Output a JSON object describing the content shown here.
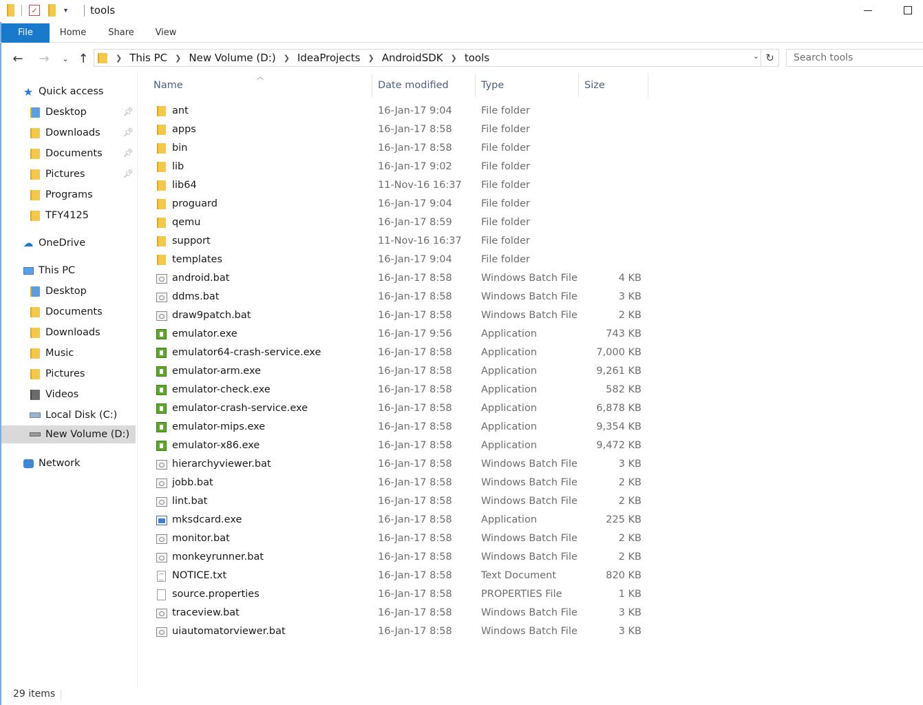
{
  "window": {
    "title": "tools"
  },
  "ribbon": {
    "tabs": [
      {
        "label": "File"
      },
      {
        "label": "Home"
      },
      {
        "label": "Share"
      },
      {
        "label": "View"
      }
    ]
  },
  "address": {
    "crumbs": [
      "This PC",
      "New Volume (D:)",
      "IdeaProjects",
      "AndroidSDK",
      "tools"
    ]
  },
  "search": {
    "placeholder": "Search tools"
  },
  "nav": {
    "items": [
      {
        "label": "Quick access",
        "icon": "star-icon",
        "level": 0
      },
      {
        "label": "Desktop",
        "icon": "desktop-folder-icon",
        "level": 1,
        "pinned": true
      },
      {
        "label": "Downloads",
        "icon": "downloads-folder-icon",
        "level": 1,
        "pinned": true
      },
      {
        "label": "Documents",
        "icon": "documents-folder-icon",
        "level": 1,
        "pinned": true
      },
      {
        "label": "Pictures",
        "icon": "pictures-folder-icon",
        "level": 1,
        "pinned": true
      },
      {
        "label": "Programs",
        "icon": "folder-icon",
        "level": 1
      },
      {
        "label": "TFY4125",
        "icon": "folder-icon",
        "level": 1
      },
      {
        "label": "OneDrive",
        "icon": "cloud-icon",
        "level": 0
      },
      {
        "label": "This PC",
        "icon": "computer-icon",
        "level": 0
      },
      {
        "label": "Desktop",
        "icon": "desktop-folder-icon",
        "level": 1
      },
      {
        "label": "Documents",
        "icon": "documents-folder-icon",
        "level": 1
      },
      {
        "label": "Downloads",
        "icon": "downloads-folder-icon",
        "level": 1
      },
      {
        "label": "Music",
        "icon": "music-folder-icon",
        "level": 1
      },
      {
        "label": "Pictures",
        "icon": "pictures-folder-icon",
        "level": 1
      },
      {
        "label": "Videos",
        "icon": "videos-folder-icon",
        "level": 1
      },
      {
        "label": "Local Disk (C:)",
        "icon": "drive-icon",
        "level": 1
      },
      {
        "label": "New Volume (D:)",
        "icon": "drive-icon",
        "level": 1,
        "selected": true
      },
      {
        "label": "Network",
        "icon": "network-icon",
        "level": 0
      }
    ]
  },
  "columns": {
    "name": "Name",
    "date": "Date modified",
    "type": "Type",
    "size": "Size"
  },
  "files": [
    {
      "name": "ant",
      "date": "16-Jan-17 9:04",
      "type": "File folder",
      "size": "",
      "icon": "folder"
    },
    {
      "name": "apps",
      "date": "16-Jan-17 8:58",
      "type": "File folder",
      "size": "",
      "icon": "folder"
    },
    {
      "name": "bin",
      "date": "16-Jan-17 8:58",
      "type": "File folder",
      "size": "",
      "icon": "folder"
    },
    {
      "name": "lib",
      "date": "16-Jan-17 9:02",
      "type": "File folder",
      "size": "",
      "icon": "folder"
    },
    {
      "name": "lib64",
      "date": "11-Nov-16 16:37",
      "type": "File folder",
      "size": "",
      "icon": "folder"
    },
    {
      "name": "proguard",
      "date": "16-Jan-17 9:04",
      "type": "File folder",
      "size": "",
      "icon": "folder"
    },
    {
      "name": "qemu",
      "date": "16-Jan-17 8:59",
      "type": "File folder",
      "size": "",
      "icon": "folder"
    },
    {
      "name": "support",
      "date": "11-Nov-16 16:37",
      "type": "File folder",
      "size": "",
      "icon": "folder"
    },
    {
      "name": "templates",
      "date": "16-Jan-17 9:04",
      "type": "File folder",
      "size": "",
      "icon": "folder"
    },
    {
      "name": "android.bat",
      "date": "16-Jan-17 8:58",
      "type": "Windows Batch File",
      "size": "4 KB",
      "icon": "bat"
    },
    {
      "name": "ddms.bat",
      "date": "16-Jan-17 8:58",
      "type": "Windows Batch File",
      "size": "3 KB",
      "icon": "bat"
    },
    {
      "name": "draw9patch.bat",
      "date": "16-Jan-17 8:58",
      "type": "Windows Batch File",
      "size": "2 KB",
      "icon": "bat"
    },
    {
      "name": "emulator.exe",
      "date": "16-Jan-17 9:56",
      "type": "Application",
      "size": "743 KB",
      "icon": "exe"
    },
    {
      "name": "emulator64-crash-service.exe",
      "date": "16-Jan-17 8:58",
      "type": "Application",
      "size": "7,000 KB",
      "icon": "exe"
    },
    {
      "name": "emulator-arm.exe",
      "date": "16-Jan-17 8:58",
      "type": "Application",
      "size": "9,261 KB",
      "icon": "exe"
    },
    {
      "name": "emulator-check.exe",
      "date": "16-Jan-17 8:58",
      "type": "Application",
      "size": "582 KB",
      "icon": "exe"
    },
    {
      "name": "emulator-crash-service.exe",
      "date": "16-Jan-17 8:58",
      "type": "Application",
      "size": "6,878 KB",
      "icon": "exe"
    },
    {
      "name": "emulator-mips.exe",
      "date": "16-Jan-17 8:58",
      "type": "Application",
      "size": "9,354 KB",
      "icon": "exe"
    },
    {
      "name": "emulator-x86.exe",
      "date": "16-Jan-17 8:58",
      "type": "Application",
      "size": "9,472 KB",
      "icon": "exe"
    },
    {
      "name": "hierarchyviewer.bat",
      "date": "16-Jan-17 8:58",
      "type": "Windows Batch File",
      "size": "3 KB",
      "icon": "bat"
    },
    {
      "name": "jobb.bat",
      "date": "16-Jan-17 8:58",
      "type": "Windows Batch File",
      "size": "2 KB",
      "icon": "bat"
    },
    {
      "name": "lint.bat",
      "date": "16-Jan-17 8:58",
      "type": "Windows Batch File",
      "size": "2 KB",
      "icon": "bat"
    },
    {
      "name": "mksdcard.exe",
      "date": "16-Jan-17 8:58",
      "type": "Application",
      "size": "225 KB",
      "icon": "exe-blue"
    },
    {
      "name": "monitor.bat",
      "date": "16-Jan-17 8:58",
      "type": "Windows Batch File",
      "size": "2 KB",
      "icon": "bat"
    },
    {
      "name": "monkeyrunner.bat",
      "date": "16-Jan-17 8:58",
      "type": "Windows Batch File",
      "size": "2 KB",
      "icon": "bat"
    },
    {
      "name": "NOTICE.txt",
      "date": "16-Jan-17 8:58",
      "type": "Text Document",
      "size": "820 KB",
      "icon": "txt"
    },
    {
      "name": "source.properties",
      "date": "16-Jan-17 8:58",
      "type": "PROPERTIES File",
      "size": "1 KB",
      "icon": "prop"
    },
    {
      "name": "traceview.bat",
      "date": "16-Jan-17 8:58",
      "type": "Windows Batch File",
      "size": "3 KB",
      "icon": "bat"
    },
    {
      "name": "uiautomatorviewer.bat",
      "date": "16-Jan-17 8:58",
      "type": "Windows Batch File",
      "size": "3 KB",
      "icon": "bat"
    }
  ],
  "status": {
    "item_count": "29 items"
  },
  "colors": {
    "file_tab": "#1979ca",
    "header_text": "#4d6082",
    "folder": "#f4c84a",
    "exe_icon": "#5ca82b",
    "selected_nav": "#d9d9d9"
  }
}
